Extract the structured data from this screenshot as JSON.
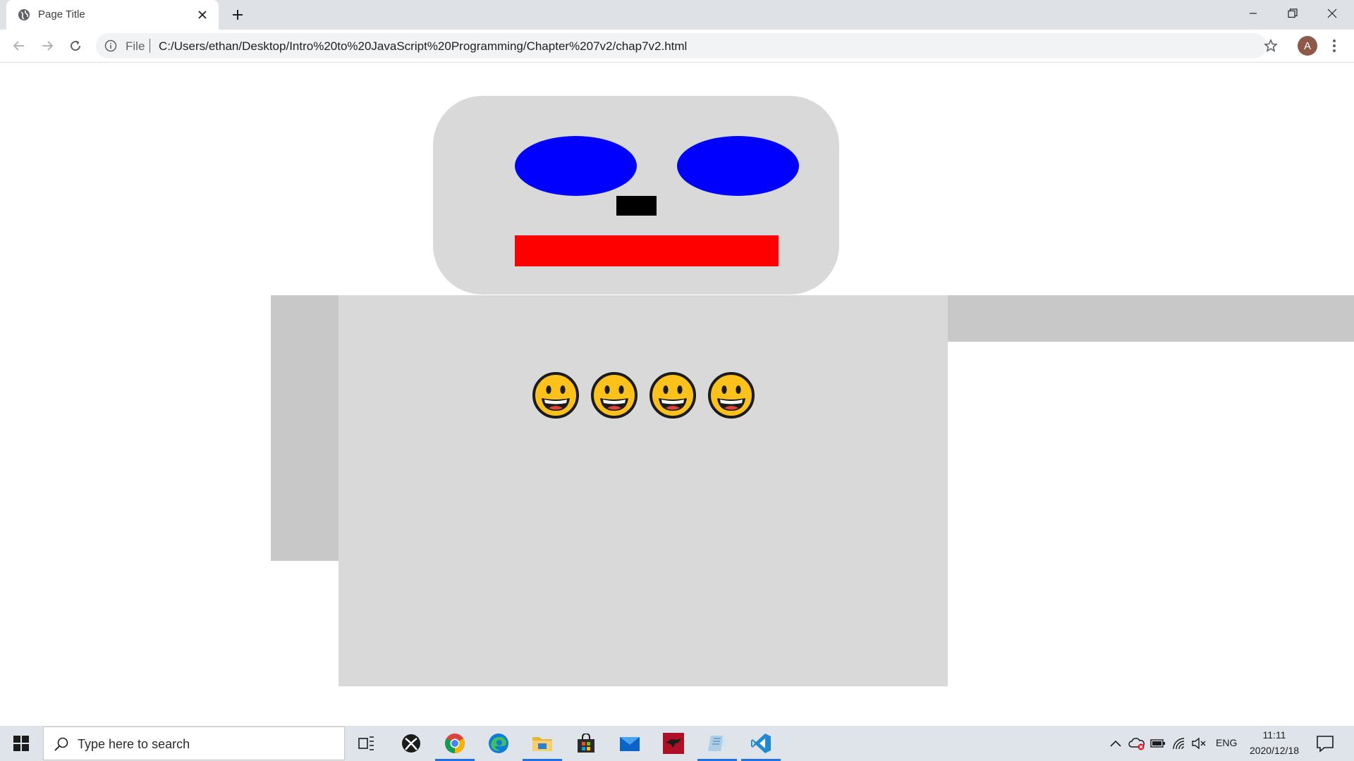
{
  "browser": {
    "tab_title": "Page Title",
    "address_scheme": "File",
    "address_url": "C:/Users/ethan/Desktop/Intro%20to%20JavaScript%20Programming/Chapter%207v2/chap7v2.html",
    "profile_initial": "A"
  },
  "robot": {
    "head_color": "#d9d9d9",
    "eye_color": "#0000ff",
    "nose_color": "#000000",
    "mouth_color": "#ff0000",
    "body_color": "#d9d9d9",
    "arm_color": "#c8c8c8",
    "smiley_count": 4,
    "smiley_icon": "grinning-face-icon"
  },
  "taskbar": {
    "search_placeholder": "Type here to search",
    "apps": [
      "task-view",
      "xbox",
      "chrome",
      "edge",
      "file-explorer",
      "store",
      "mail",
      "game",
      "notepad",
      "vscode"
    ],
    "language": "ENG",
    "time": "11:11",
    "date": "2020/12/18"
  }
}
